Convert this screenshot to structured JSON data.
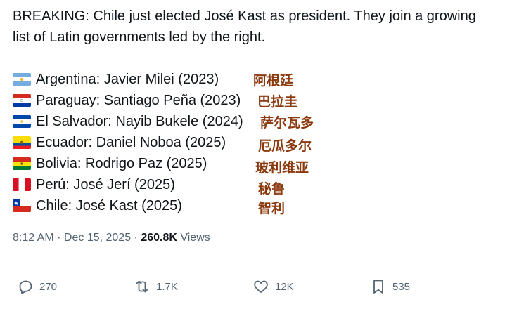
{
  "tweet": {
    "text_line1": "BREAKING: Chile just elected José Kast as president. They join a growing",
    "text_line2": "list of Latin governments led by the right."
  },
  "list": [
    {
      "country": "Argentina",
      "text": "Argentina: Javier Milei (2023)",
      "chinese": "阿根廷",
      "flag": "argentina"
    },
    {
      "country": "Paraguay",
      "text": "Paraguay: Santiago Peña (2023)",
      "chinese": "巴拉圭",
      "flag": "paraguay"
    },
    {
      "country": "El Salvador",
      "text": "El Salvador: Nayib Bukele (2024)",
      "chinese": "萨尔瓦多",
      "flag": "el-salvador"
    },
    {
      "country": "Ecuador",
      "text": "Ecuador: Daniel Noboa (2025)",
      "chinese": "厄瓜多尔",
      "flag": "ecuador"
    },
    {
      "country": "Bolivia",
      "text": "Bolivia: Rodrigo Paz (2025)",
      "chinese": "玻利维亚",
      "flag": "bolivia"
    },
    {
      "country": "Perú",
      "text": "Perú: José Jerí (2025)",
      "chinese": "秘鲁",
      "flag": "peru"
    },
    {
      "country": "Chile",
      "text": "Chile: José Kast (2025)",
      "chinese": "智利",
      "flag": "chile"
    }
  ],
  "meta": {
    "timestamp": "8:12 AM · Dec 15, 2025 · ",
    "views_count": "260.8K",
    "views_label": " Views"
  },
  "actions": {
    "replies": "270",
    "reposts": "1.7K",
    "likes": "12K",
    "bookmarks": "535"
  },
  "colors": {
    "text": "#0f1419",
    "muted": "#536471",
    "annotation": "#8b3a0e"
  }
}
